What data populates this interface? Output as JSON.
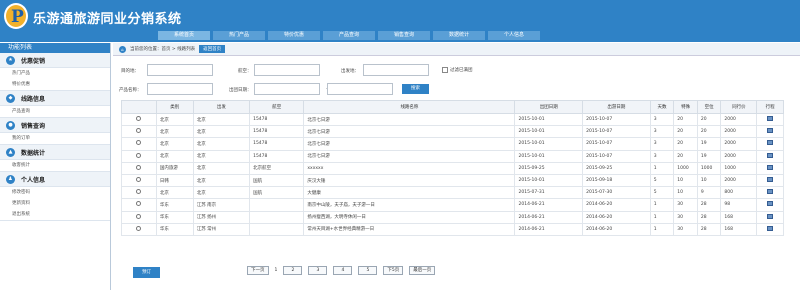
{
  "app": {
    "logo_letter": "P",
    "title": "乐游通旅游同业分销系统"
  },
  "topnav": [
    "系统首页",
    "热门产品",
    "特价优惠",
    "产品查询",
    "销售查询",
    "数据统计",
    "个人信息"
  ],
  "sidebar": {
    "title": "功能列表",
    "groups": [
      {
        "title": "优惠促销",
        "items": [
          "热门产品",
          "特价优惠"
        ]
      },
      {
        "title": "线路信息",
        "items": [
          "产品查询"
        ]
      },
      {
        "title": "销售查询",
        "items": [
          "我的订单"
        ]
      },
      {
        "title": "数据统计",
        "items": [
          "收客统计"
        ]
      },
      {
        "title": "个人信息",
        "items": [
          "修改密码",
          "更新资料",
          "退出系统"
        ]
      }
    ]
  },
  "breadcrumb": {
    "text": "当前您的位置：首页 > 线路列表",
    "back": "返回首页"
  },
  "filters": {
    "origin_label": "目的地：",
    "flight_label": "航空：",
    "depart_label": "出发地：",
    "outdated_label": "过滤已满团",
    "product_label": "产品名称：",
    "date_label": "出团日期：",
    "range_sep": "—",
    "search": "搜索"
  },
  "table": {
    "headers": [
      "",
      "类别",
      "出发",
      "航空",
      "线路名称",
      "出团日期",
      "出游日期",
      "天数",
      "特殊",
      "空位",
      "同行价",
      "行程"
    ],
    "rows": [
      [
        "",
        "北京",
        "北京",
        "15478",
        "北京七日游",
        "2015-10-01",
        "2015-10-07",
        "3",
        "20",
        "20",
        "2000",
        ""
      ],
      [
        "",
        "北京",
        "北京",
        "15478",
        "北京七日游",
        "2015-10-01",
        "2015-10-07",
        "3",
        "20",
        "20",
        "2000",
        ""
      ],
      [
        "",
        "北京",
        "北京",
        "15478",
        "北京七日游",
        "2015-10-01",
        "2015-10-07",
        "3",
        "20",
        "19",
        "2000",
        ""
      ],
      [
        "",
        "北京",
        "北京",
        "15478",
        "北京七日游",
        "2015-10-01",
        "2015-10-07",
        "3",
        "20",
        "19",
        "2000",
        ""
      ],
      [
        "",
        "国内旅游",
        "北京",
        "北京航空",
        "xxxxxx",
        "2015-09-25",
        "2015-09-25",
        "1",
        "1000",
        "1000",
        "1000",
        ""
      ],
      [
        "",
        "日韩",
        "北京",
        "国航",
        "庆汉大锤",
        "2015-10-01",
        "2015-09-18",
        "5",
        "10",
        "10",
        "2000",
        ""
      ],
      [
        "",
        "北京",
        "北京",
        "国航",
        "大健康",
        "2015-07-31",
        "2015-07-30",
        "5",
        "10",
        "9",
        "800",
        ""
      ],
      [
        "",
        "华东",
        "江苏 南京",
        "",
        "南京中山陵，夫子庙，夫子游一日",
        "2014-06-21",
        "2014-06-20",
        "1",
        "30",
        "28",
        "98",
        ""
      ],
      [
        "",
        "华东",
        "江苏 扬州",
        "",
        "扬州瘦西湖，大明寺休闲一日",
        "2014-06-21",
        "2014-06-20",
        "1",
        "30",
        "28",
        "168",
        ""
      ],
      [
        "",
        "华东",
        "江苏 常州",
        "",
        "常州天目湖+水世界经典精游一日",
        "2014-06-21",
        "2014-06-20",
        "1",
        "30",
        "28",
        "168",
        ""
      ]
    ]
  },
  "book": "预订",
  "pager": {
    "prev": "下一页",
    "current": "1",
    "pages": [
      "2",
      "3",
      "4",
      "5"
    ],
    "next": "下5页",
    "last": "最后一页"
  }
}
